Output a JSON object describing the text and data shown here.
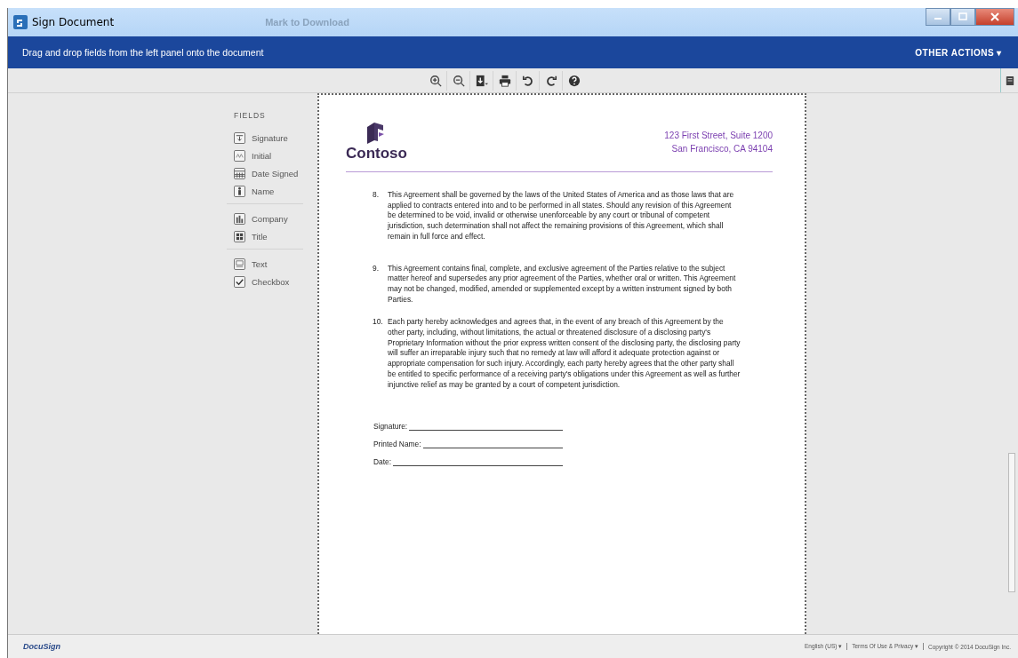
{
  "window": {
    "title": "Sign Document",
    "background_text": "Mark to Download"
  },
  "header": {
    "instruction": "Drag and drop fields from the left panel onto the document",
    "menu": "OTHER ACTIONS ▾"
  },
  "toolbar": [
    {
      "kind": "zoom-in"
    },
    {
      "kind": "zoom-out"
    },
    {
      "kind": "download"
    },
    {
      "kind": "print"
    },
    {
      "kind": "rotate-left"
    },
    {
      "kind": "rotate-right"
    },
    {
      "kind": "help"
    }
  ],
  "fields": {
    "heading": "FIELDS",
    "groups": [
      [
        {
          "label": "Signature",
          "kind": "signature"
        },
        {
          "label": "Initial",
          "kind": "initial"
        },
        {
          "label": "Date Signed",
          "kind": "date"
        },
        {
          "label": "Name",
          "kind": "person"
        }
      ],
      [
        {
          "label": "Company",
          "kind": "company"
        },
        {
          "label": "Title",
          "kind": "title"
        }
      ],
      [
        {
          "label": "Text",
          "kind": "text"
        },
        {
          "label": "Checkbox",
          "kind": "checkbox"
        }
      ]
    ]
  },
  "document": {
    "company": "Contoso",
    "address": [
      "123 First Street, Suite 1200",
      "San Francisco, CA 94104"
    ],
    "clauses": [
      {
        "number": "8.",
        "text": "This Agreement shall be governed by the laws of the United States of America and as those laws that are applied to contracts entered into and to be performed in all states. Should any revision of this Agreement be determined to be void, invalid or otherwise unenforceable by any court or tribunal of competent jurisdiction, such determination shall not affect the remaining provisions of this Agreement, which shall remain in full force and effect."
      },
      {
        "number": "9.",
        "text": "This Agreement contains final, complete, and exclusive agreement of the Parties relative to the subject matter hereof and supersedes any prior agreement of the Parties, whether oral or written. This Agreement may not be changed, modified, amended or supplemented except by a written instrument signed by both Parties."
      },
      {
        "number": "10.",
        "text": "Each party hereby acknowledges and agrees that, in the event of any breach of this Agreement by the other party, including, without limitations, the actual or threatened disclosure of a disclosing party's Proprietary Information without the prior express written consent of the disclosing party, the disclosing party will suffer an irreparable injury such that no remedy at law will afford it adequate protection against or appropriate compensation for such injury. Accordingly, each party hereby agrees that the other party shall be entitled to specific performance of a receiving party's obligations under this Agreement as well as further injunctive relief as may be granted by a court of competent jurisdiction."
      }
    ],
    "sign_lines": [
      "Signature:",
      "Printed Name:",
      "Date:"
    ]
  },
  "footer": {
    "logo": "DocuSign",
    "links": [
      "English (US) ▾",
      "Terms Of Use & Privacy ▾",
      "Copyright © 2014 DocuSign Inc."
    ]
  }
}
